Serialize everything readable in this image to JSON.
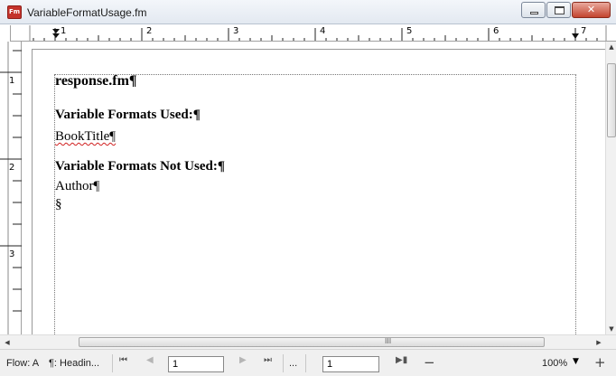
{
  "window": {
    "title": "VariableFormatUsage.fm",
    "icon": "Fm",
    "controls": [
      "minimize-icon",
      "maximize-icon",
      "close-icon"
    ]
  },
  "ruler": {
    "horizontal_numbers": [
      "1",
      "2",
      "3",
      "4",
      "5",
      "6",
      "7"
    ],
    "vertical_numbers": [
      "1",
      "2",
      "3"
    ]
  },
  "document": {
    "filename_heading": "response.fm¶",
    "used_heading": "Variable Formats Used:¶",
    "used_items": [
      "BookTitle¶"
    ],
    "not_used_heading": "Variable Formats Not Used:¶",
    "not_used_items": [
      "Author¶"
    ],
    "section_mark": "§"
  },
  "statusbar": {
    "flow": "Flow: A",
    "paragraph_tag": "¶: Headin...",
    "page_number": "1",
    "dots": "...",
    "second_box": "1",
    "zoom": "100%",
    "zoom_out": "−",
    "zoom_in": "+"
  },
  "scrollbar": {
    "grip": "III"
  }
}
